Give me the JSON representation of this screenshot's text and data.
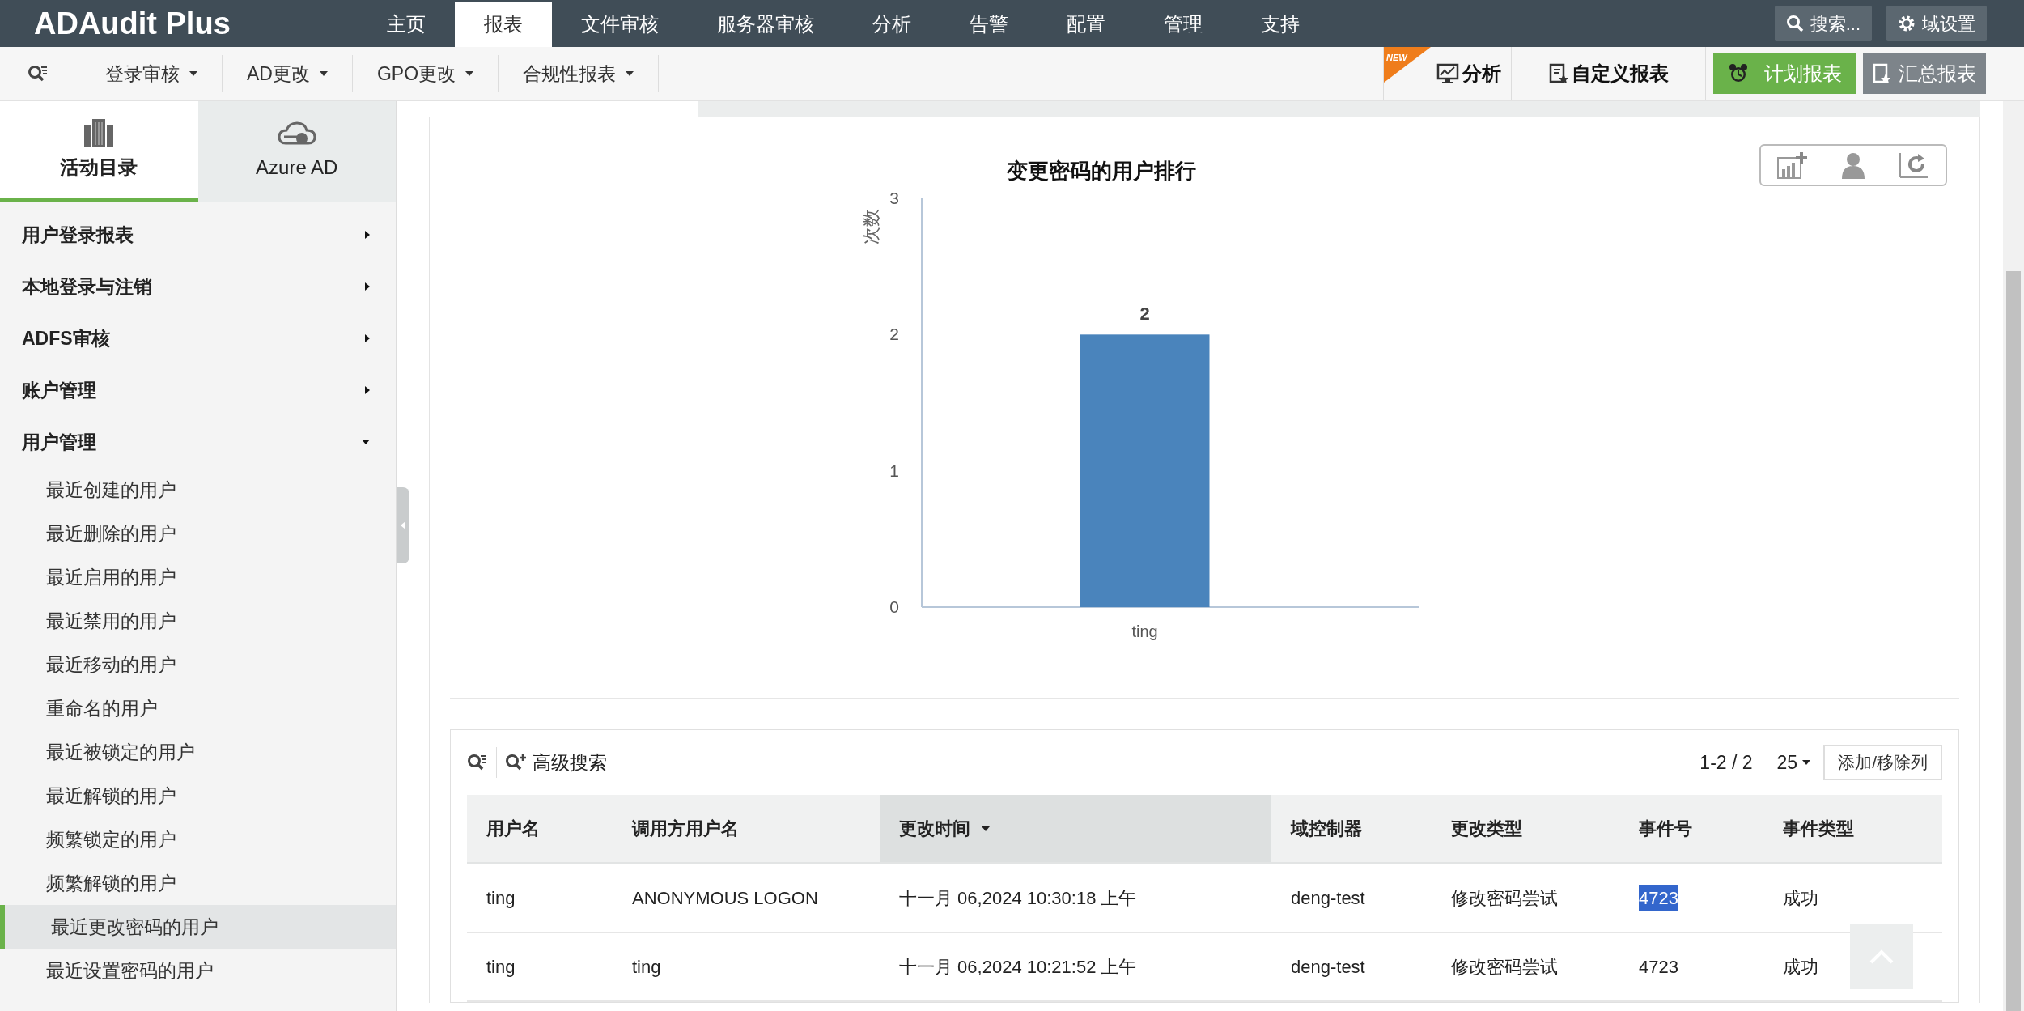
{
  "app": {
    "title": "ADAudit Plus"
  },
  "top_nav": [
    {
      "label": "主页",
      "selected": false
    },
    {
      "label": "报表",
      "selected": true
    },
    {
      "label": "文件审核",
      "selected": false
    },
    {
      "label": "服务器审核",
      "selected": false
    },
    {
      "label": "分析",
      "selected": false
    },
    {
      "label": "告警",
      "selected": false
    },
    {
      "label": "配置",
      "selected": false
    },
    {
      "label": "管理",
      "selected": false
    },
    {
      "label": "支持",
      "selected": false
    }
  ],
  "top_actions": {
    "search": "搜索...",
    "domain_settings": "域设置"
  },
  "sub_nav": [
    "登录审核",
    "AD更改",
    "GPO更改",
    "合规性报表"
  ],
  "sub_actions": {
    "new_badge": "NEW",
    "analysis": "分析",
    "custom_report": "自定义报表",
    "schedule_report": "计划报表",
    "summary_report": "汇总报表"
  },
  "sidebar": {
    "tabs": [
      {
        "label": "活动目录",
        "kind": "building",
        "selected": true
      },
      {
        "label": "Azure AD",
        "kind": "cloud",
        "selected": false
      }
    ],
    "sections": [
      {
        "label": "用户登录报表",
        "expanded": false
      },
      {
        "label": "本地登录与注销",
        "expanded": false
      },
      {
        "label": "ADFS审核",
        "expanded": false
      },
      {
        "label": "账户管理",
        "expanded": false
      },
      {
        "label": "用户管理",
        "expanded": true,
        "children": [
          {
            "label": "最近创建的用户",
            "selected": false
          },
          {
            "label": "最近删除的用户",
            "selected": false
          },
          {
            "label": "最近启用的用户",
            "selected": false
          },
          {
            "label": "最近禁用的用户",
            "selected": false
          },
          {
            "label": "最近移动的用户",
            "selected": false
          },
          {
            "label": "重命名的用户",
            "selected": false
          },
          {
            "label": "最近被锁定的用户",
            "selected": false
          },
          {
            "label": "最近解锁的用户",
            "selected": false
          },
          {
            "label": "频繁锁定的用户",
            "selected": false
          },
          {
            "label": "频繁解锁的用户",
            "selected": false
          },
          {
            "label": "最近更改密码的用户",
            "selected": true
          },
          {
            "label": "最近设置密码的用户",
            "selected": false
          }
        ]
      }
    ]
  },
  "chart": {
    "chart_data": {
      "type": "bar",
      "title": "变更密码的用户排行",
      "ylabel": "次数",
      "categories": [
        "ting"
      ],
      "values": [
        2
      ],
      "ylim": [
        0,
        3
      ],
      "yticks": [
        0,
        1,
        2,
        3
      ],
      "data_labels": true
    }
  },
  "table": {
    "advanced_search": "高级搜索",
    "paging": "1-2 / 2",
    "page_size": "25",
    "columns_button": "添加/移除列",
    "columns": [
      {
        "label": "用户名",
        "sorted": false
      },
      {
        "label": "调用方用户名",
        "sorted": false
      },
      {
        "label": "更改时间",
        "sorted": true
      },
      {
        "label": "域控制器",
        "sorted": false
      },
      {
        "label": "更改类型",
        "sorted": false
      },
      {
        "label": "事件号",
        "sorted": false
      },
      {
        "label": "事件类型",
        "sorted": false
      }
    ],
    "rows": [
      {
        "cells": [
          {
            "text": "ting",
            "highlighted": false
          },
          {
            "text": "ANONYMOUS LOGON",
            "highlighted": false
          },
          {
            "text": "十一月 06,2024 10:30:18 上午",
            "highlighted": false
          },
          {
            "text": "deng-test",
            "highlighted": false
          },
          {
            "text": "修改密码尝试",
            "highlighted": false
          },
          {
            "text": "4723",
            "highlighted": true
          },
          {
            "text": "成功",
            "highlighted": false
          }
        ]
      },
      {
        "cells": [
          {
            "text": "ting",
            "highlighted": false
          },
          {
            "text": "ting",
            "highlighted": false
          },
          {
            "text": "十一月 06,2024 10:21:52 上午",
            "highlighted": false
          },
          {
            "text": "deng-test",
            "highlighted": false
          },
          {
            "text": "修改密码尝试",
            "highlighted": false
          },
          {
            "text": "4723",
            "highlighted": false
          },
          {
            "text": "成功",
            "highlighted": false
          }
        ]
      }
    ]
  }
}
